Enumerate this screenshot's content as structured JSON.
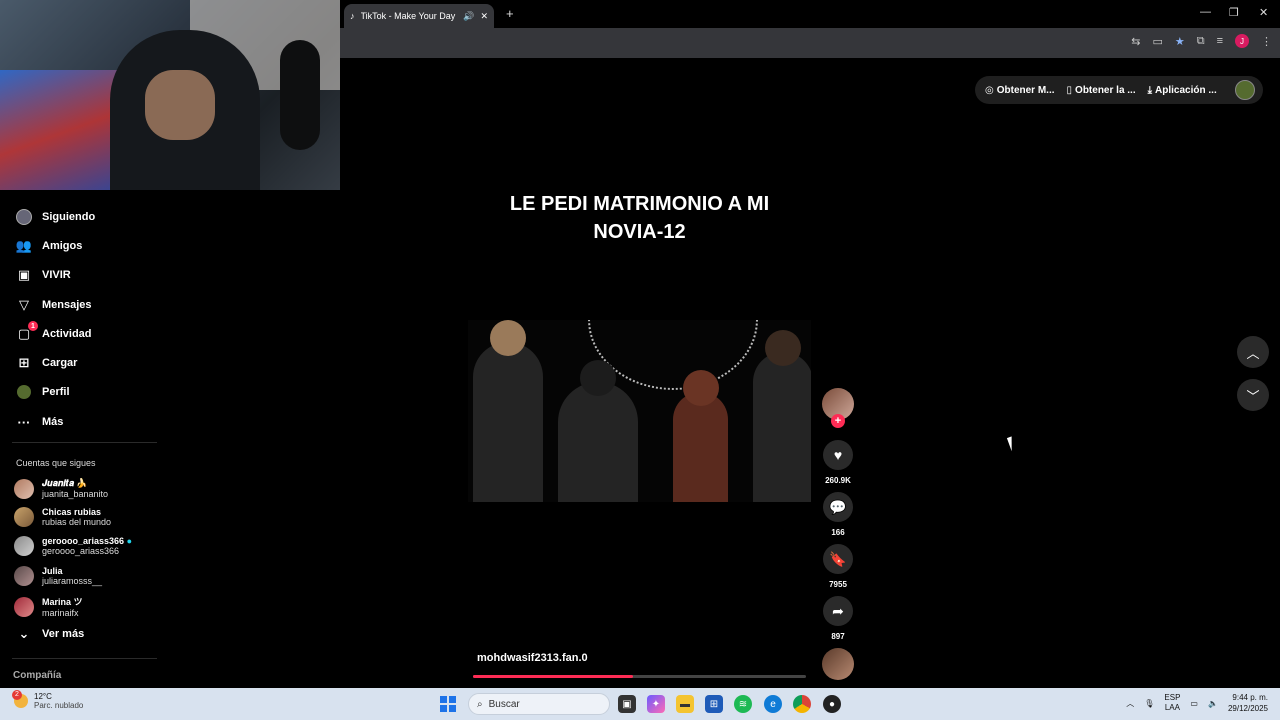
{
  "browser": {
    "tab_title": "TikTok - Make Your Day",
    "new_tab": "+",
    "minimize": "—",
    "restore": "❐",
    "close": "✕",
    "profile_initial": "J"
  },
  "top_actions": {
    "item1": "Obtener M...",
    "item2": "Obtener la ...",
    "item3": "Aplicación ..."
  },
  "sidebar": {
    "items": [
      {
        "label": "Siguiendo",
        "icon": "following-avatar-icon"
      },
      {
        "label": "Amigos",
        "icon": "friends-icon"
      },
      {
        "label": "VIVIR",
        "icon": "live-icon"
      },
      {
        "label": "Mensajes",
        "icon": "messages-icon"
      },
      {
        "label": "Actividad",
        "icon": "activity-icon",
        "badge": "1"
      },
      {
        "label": "Cargar",
        "icon": "upload-icon"
      },
      {
        "label": "Perfil",
        "icon": "profile-icon"
      },
      {
        "label": "Más",
        "icon": "more-icon"
      }
    ],
    "following_title": "Cuentas que sigues",
    "following": [
      {
        "name": "𝑱𝒖𝒂𝒏𝒊𝒕𝒂 🍌",
        "handle": "juanita_bananito"
      },
      {
        "name": "Chicas rubias",
        "handle": "rubias del mundo"
      },
      {
        "name": "geroooo_ariass366",
        "handle": "geroooo_ariass366",
        "verified": true
      },
      {
        "name": "Julia",
        "handle": "juliaramosss__"
      },
      {
        "name": "Marina ツ",
        "handle": "marinaifx"
      }
    ],
    "see_more": "Ver más",
    "company": "Compañía"
  },
  "video": {
    "title_line1": "LE PEDI MATRIMONIO A MI",
    "title_line2": "NOVIA-12",
    "username": "mohdwasif2313.fan.0",
    "progress": 0.48
  },
  "rail": {
    "likes": "260.9K",
    "comments": "166",
    "saves": "7955",
    "shares": "897",
    "follow_plus": "+"
  },
  "taskbar": {
    "weather_badge": "2",
    "temp": "12°C",
    "condition": "Parc. nublado",
    "search": "Buscar",
    "lang_line1": "ESP",
    "lang_line2": "LAA",
    "time": "9:44 p. m.",
    "date": "29/12/2025"
  }
}
